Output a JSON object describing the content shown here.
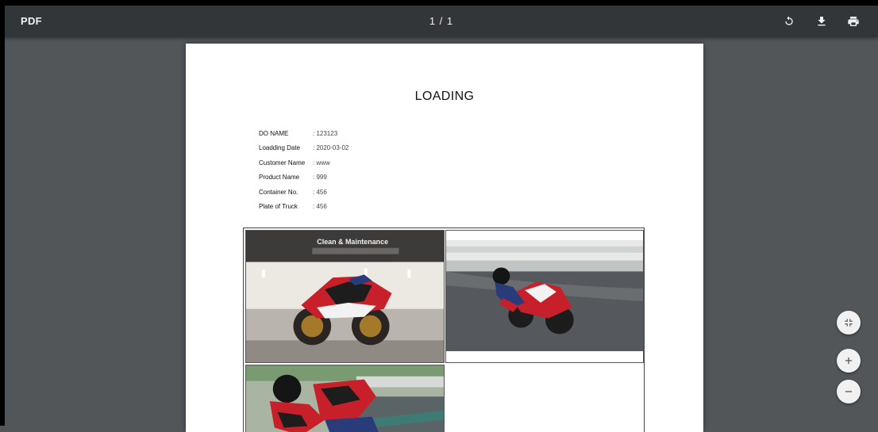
{
  "toolbar": {
    "title": "PDF",
    "page_indicator": "1 / 1",
    "rotate_icon": "rotate-icon",
    "download_icon": "download-icon",
    "print_icon": "print-icon"
  },
  "document": {
    "title": "LOADING",
    "fields": [
      {
        "label": "DO NAME",
        "value": ": 123123"
      },
      {
        "label": "Loadding Date",
        "value": ": 2020-03-02"
      },
      {
        "label": "Customer Name",
        "value": ": www"
      },
      {
        "label": "Product Name",
        "value": ": 999"
      },
      {
        "label": "Container No.",
        "value": ": 456"
      },
      {
        "label": "Plate of Truck",
        "value": ": 456"
      }
    ],
    "photos": [
      {
        "name": "motorcycle-showroom-photo",
        "banner_text": "Clean & Maintenance"
      },
      {
        "name": "motorcycle-track-photo"
      },
      {
        "name": "rider-closeup-photo"
      }
    ]
  },
  "zoom_controls": {
    "fit_icon": "fit-to-page-icon",
    "zoom_in_icon": "plus-icon",
    "zoom_out_icon": "minus-icon"
  },
  "colors": {
    "toolbar_bg": "#323639",
    "viewer_bg": "#525659",
    "paper_bg": "#ffffff",
    "bike_red": "#c8202a"
  }
}
